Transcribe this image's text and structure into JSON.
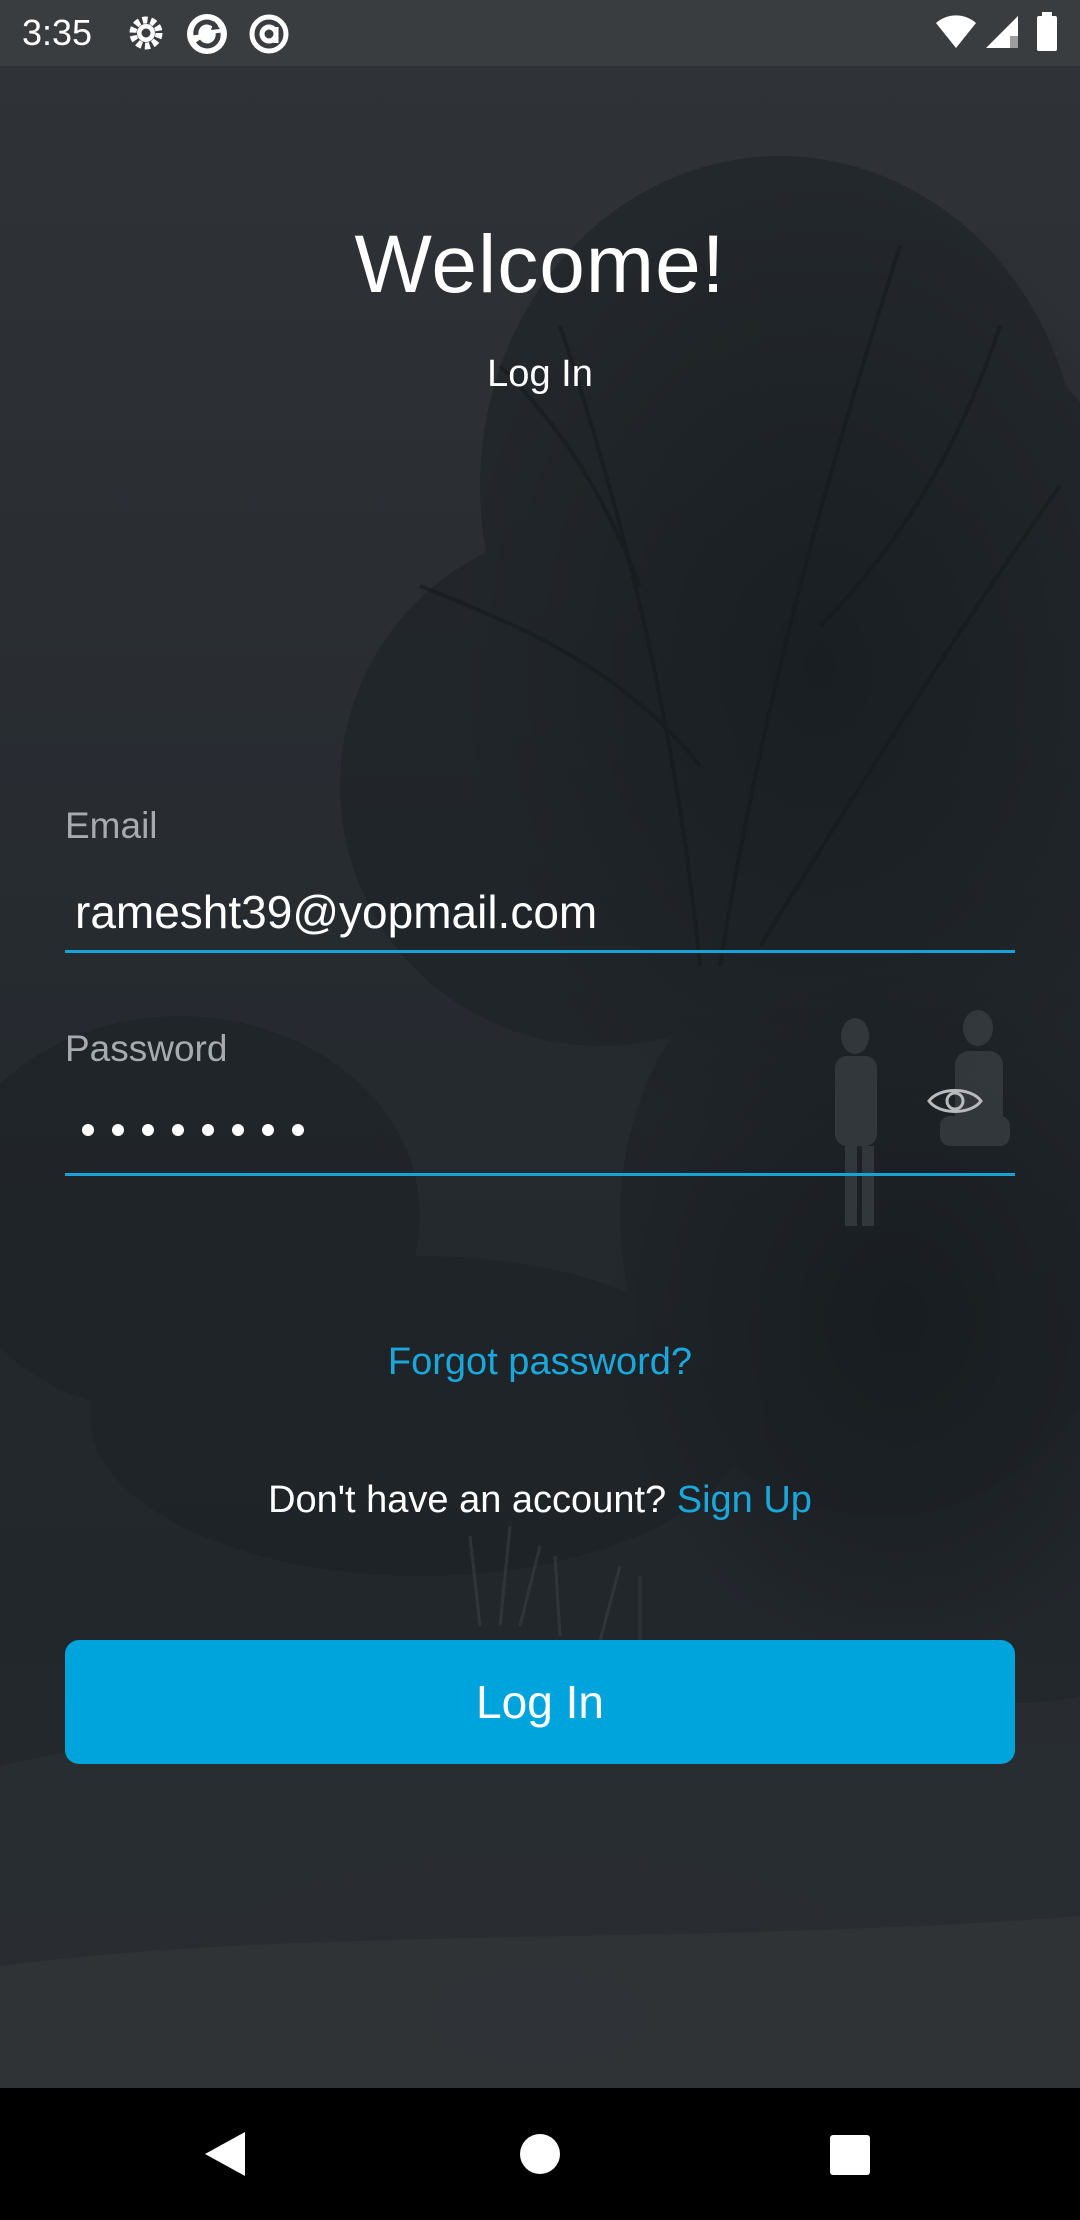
{
  "status_bar": {
    "time": "3:35",
    "left_icons": [
      "gear-icon",
      "sync-icon",
      "at-sign-icon"
    ],
    "right_icons": [
      "wifi-icon",
      "cellular-signal-icon",
      "battery-icon"
    ]
  },
  "header": {
    "title": "Welcome!",
    "subtitle": "Log In"
  },
  "form": {
    "email_label": "Email",
    "email_value": "ramesht39@yopmail.com",
    "password_label": "Password",
    "password_masked_length": 8,
    "password_toggle_icon": "eye-icon",
    "forgot_password": "Forgot password?",
    "no_account_text": "Don't have an account?",
    "signup_link": "Sign Up",
    "login_button": "Log In"
  },
  "nav_bar": {
    "buttons": [
      "back-icon",
      "home-icon",
      "recents-icon"
    ]
  },
  "colors": {
    "accent": "#00a4dc",
    "link": "#1aa7dc",
    "status_bar": "#3a3d40",
    "label": "#a8abae"
  }
}
